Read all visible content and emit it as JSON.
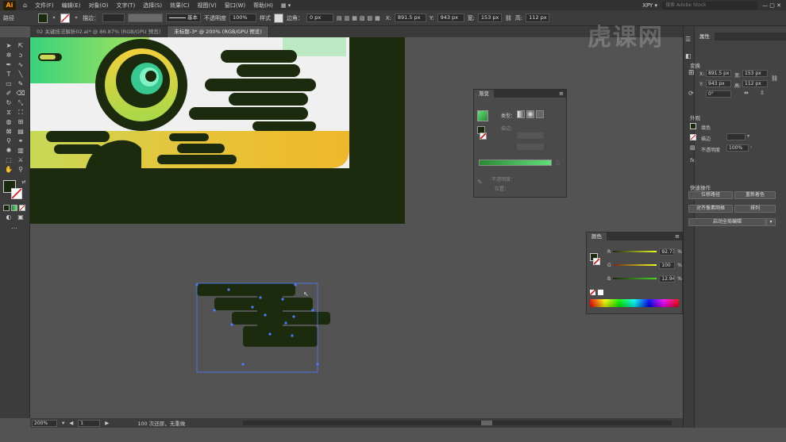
{
  "app": {
    "logo": "Ai",
    "user": "XPY ▾",
    "search_placeholder": "搜索 Adobe Stock"
  },
  "menu": [
    "文件(F)",
    "编辑(E)",
    "对象(O)",
    "文字(T)",
    "选择(S)",
    "效果(C)",
    "视图(V)",
    "窗口(W)",
    "帮助(H)"
  ],
  "control": {
    "label_path": "路径",
    "stroke_label": "描边：",
    "stroke_value": "",
    "brush_label": "基本",
    "opacity_label": "不透明度",
    "opacity_value": "100%",
    "style_label": "样式",
    "corner_label": "边角：",
    "corner_value": "0 px",
    "x_label": "X:",
    "x_value": "891.5 px",
    "y_label": "Y:",
    "y_value": "943 px",
    "w_label": "宽:",
    "w_value": "153 px",
    "h_label": "高:",
    "h_value": "112 px",
    "colors": {
      "fill": "#1a2a0d",
      "accent": "#ff9a00"
    }
  },
  "tabs": [
    {
      "label": "02 关键技法解析02.ai* @ 86.87% (RGB/GPU 预览)",
      "active": false
    },
    {
      "label": "未标题-3* @ 200% (RGB/GPU 预览)",
      "active": true
    }
  ],
  "status": {
    "zoom": "200%",
    "artboard": "1",
    "info": "100 次还原，无重做"
  },
  "watermark": "虎课网",
  "gradient_panel": {
    "title": "渐变",
    "type_label": "类型：",
    "stroke_label": "描边：",
    "opacity_label": "不透明度：",
    "position_label": "位置：",
    "colors": {
      "start": "#2b8a36",
      "end": "#61e07a"
    }
  },
  "color_panel": {
    "title": "颜色",
    "channels": [
      {
        "label": "R",
        "value": "92.73"
      },
      {
        "label": "G",
        "value": "100"
      },
      {
        "label": "B",
        "value": "12.94"
      }
    ],
    "unit": "%",
    "fill": "#1a2a0d"
  },
  "properties": {
    "title": "属性",
    "section_transform": "变换",
    "x": "891.5 px",
    "y": "153 px",
    "w": "943 px",
    "h": "112 px",
    "angle": "0°",
    "section_appearance": "外观",
    "fill_label": "填色",
    "stroke_label": "描边",
    "opacity_label": "不透明度",
    "opacity_value": "100%",
    "fx_label": "fx.",
    "section_quick": "快速操作",
    "btn_offset": "位移路径",
    "btn_recolor": "重新着色",
    "btn_align_pixel": "对齐像素网格",
    "btn_arrange": "排列",
    "btn_global_edit": "启动全局编辑"
  }
}
